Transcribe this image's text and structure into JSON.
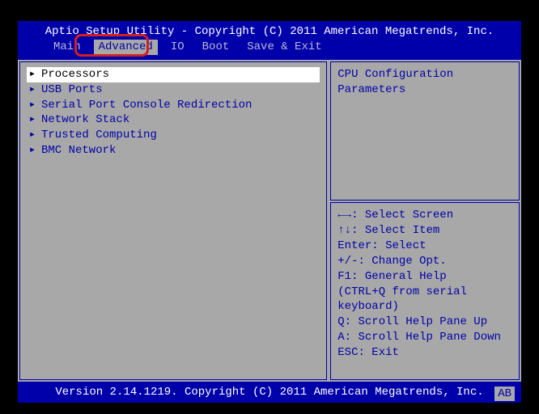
{
  "header": {
    "title": "Aptio Setup Utility - Copyright (C) 2011 American Megatrends, Inc.",
    "tabs": [
      {
        "label": "Main"
      },
      {
        "label": "Advanced"
      },
      {
        "label": "IO"
      },
      {
        "label": "Boot"
      },
      {
        "label": "Save & Exit"
      }
    ],
    "active_tab_index": 1
  },
  "menu": {
    "items": [
      {
        "label": "Processors",
        "selected": true
      },
      {
        "label": "USB Ports"
      },
      {
        "label": "Serial Port Console Redirection"
      },
      {
        "label": "Network Stack"
      },
      {
        "label": "Trusted Computing"
      },
      {
        "label": "BMC Network"
      }
    ]
  },
  "description": {
    "line1": "CPU Configuration",
    "line2": "Parameters"
  },
  "help": {
    "lines": [
      "←→: Select Screen",
      "↑↓: Select Item",
      "Enter: Select",
      "+/-: Change Opt.",
      "F1: General Help",
      "(CTRL+Q from serial",
      "keyboard)",
      "Q: Scroll Help Pane Up",
      "A: Scroll Help Pane Down",
      "ESC: Exit"
    ]
  },
  "footer": {
    "version": "Version 2.14.1219. Copyright (C) 2011 American Megatrends, Inc.",
    "tag": "AB"
  },
  "glyphs": {
    "submenu_arrow": "▸"
  }
}
